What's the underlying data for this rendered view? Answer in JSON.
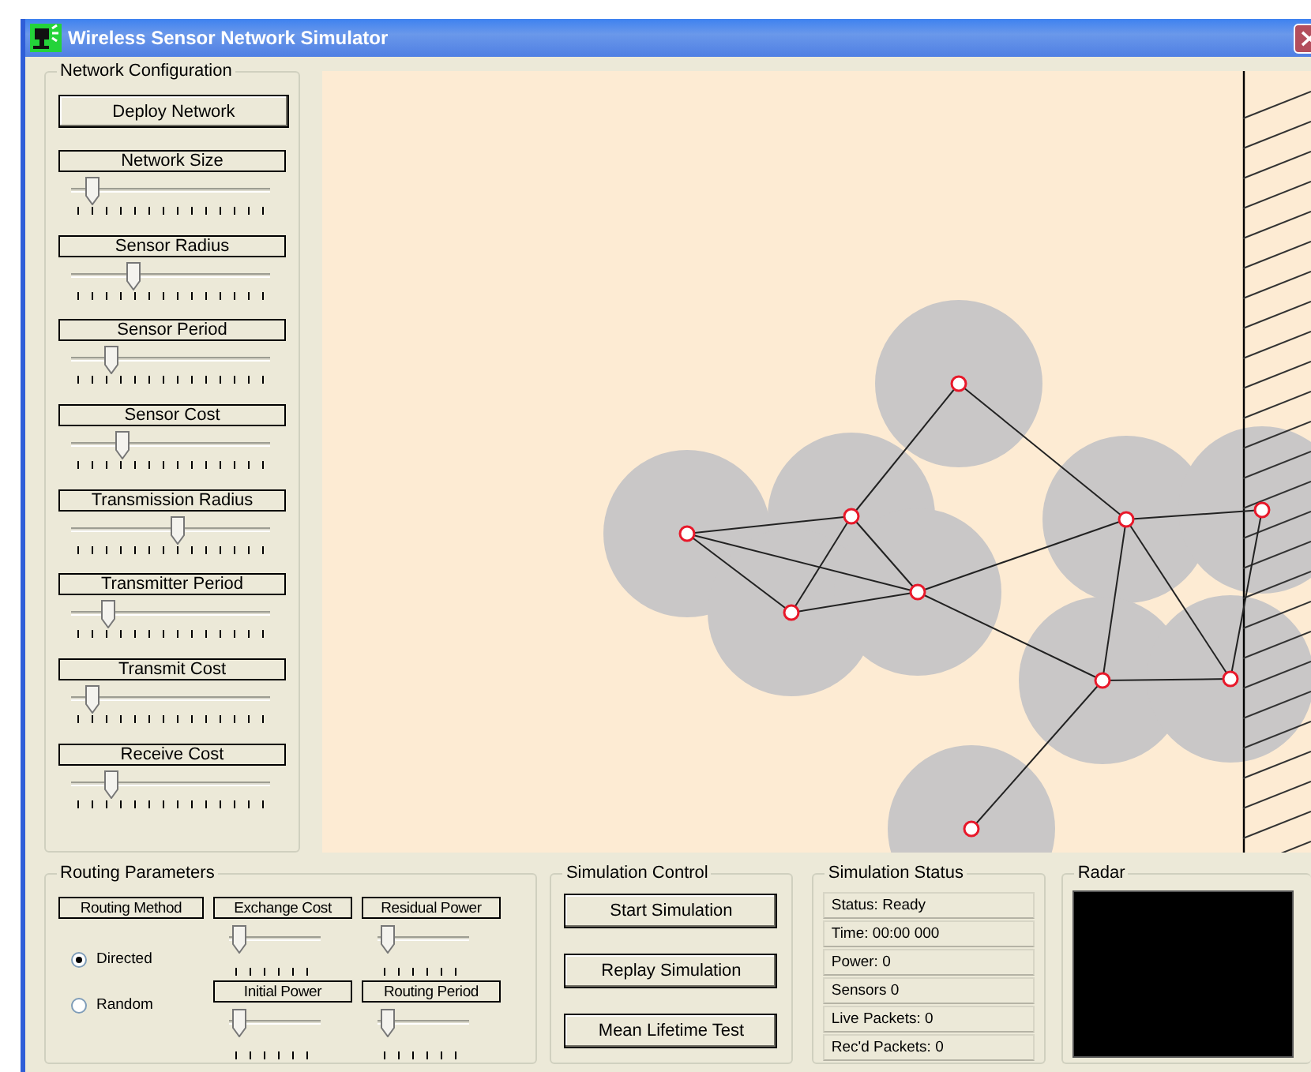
{
  "window": {
    "title": "Wireless Sensor Network Simulator"
  },
  "network_configuration": {
    "title": "Network Configuration",
    "deploy_button": "Deploy Network",
    "sliders": [
      {
        "label": "Network Size",
        "level": 0.08
      },
      {
        "label": "Sensor Radius",
        "level": 0.3
      },
      {
        "label": "Sensor Period",
        "level": 0.18
      },
      {
        "label": "Sensor Cost",
        "level": 0.24
      },
      {
        "label": "Transmission Radius",
        "level": 0.54
      },
      {
        "label": "Transmitter Period",
        "level": 0.16
      },
      {
        "label": "Transmit Cost",
        "level": 0.08
      },
      {
        "label": "Receive Cost",
        "level": 0.18
      }
    ]
  },
  "routing_parameters": {
    "title": "Routing Parameters",
    "method_label": "Routing Method",
    "methods": [
      {
        "label": "Directed",
        "selected": true
      },
      {
        "label": "Random",
        "selected": false
      }
    ],
    "sliders": [
      {
        "label": "Exchange Cost",
        "level": 0.05
      },
      {
        "label": "Residual Power",
        "level": 0.05
      },
      {
        "label": "Initial Power",
        "level": 0.05
      },
      {
        "label": "Routing Period",
        "level": 0.05
      }
    ]
  },
  "simulation_control": {
    "title": "Simulation Control",
    "buttons": [
      "Start Simulation",
      "Replay Simulation",
      "Mean Lifetime Test"
    ]
  },
  "simulation_status": {
    "title": "Simulation Status",
    "lines": [
      "Status: Ready",
      "Time: 00:00 000",
      "Power: 0",
      "Sensors  0",
      "Live Packets: 0",
      "Rec'd Packets: 0"
    ]
  },
  "radar": {
    "title": "Radar"
  }
}
